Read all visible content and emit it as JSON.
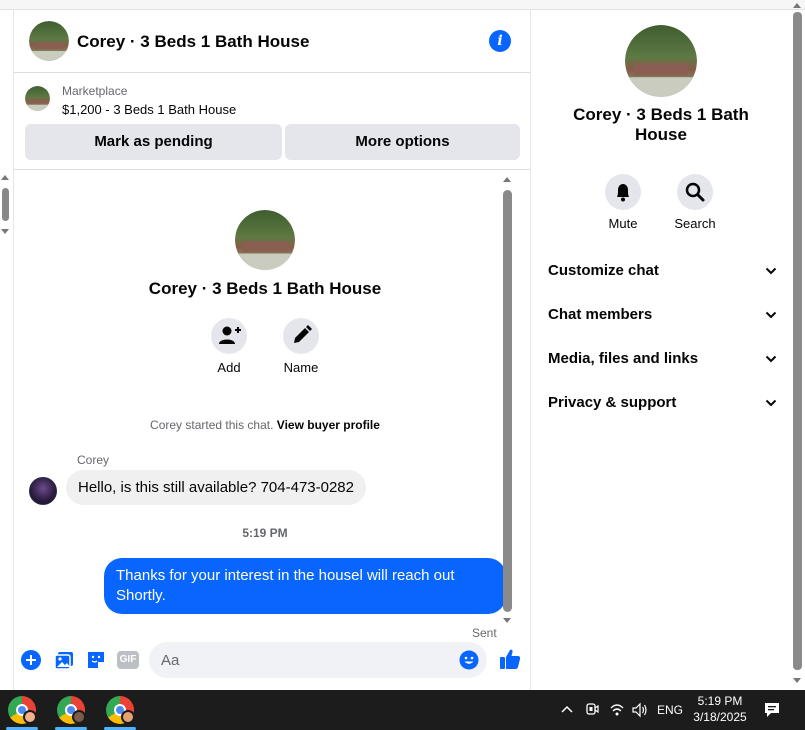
{
  "chat": {
    "title": "Corey · 3 Beds 1 Bath House"
  },
  "listing": {
    "marketplace_label": "Marketplace",
    "price_title": "$1,200 - 3 Beds 1 Bath House",
    "mark_pending_label": "Mark as pending",
    "more_options_label": "More options"
  },
  "intro": {
    "title": "Corey · 3 Beds 1 Bath House",
    "add_label": "Add",
    "name_label": "Name",
    "started_text": "Corey started this chat.",
    "view_profile_link": "View buyer profile"
  },
  "messages": {
    "sender_name": "Corey",
    "incoming_text": "Hello, is this still available? 704-473-0282",
    "timestamp": "5:19 PM",
    "outgoing_text": "Thanks for your interest in the housel will reach out Shortly.",
    "sent_label": "Sent"
  },
  "composer": {
    "placeholder": "Aa",
    "gif_label": "GIF"
  },
  "sidebar": {
    "title": "Corey · 3 Beds 1 Bath House",
    "mute_label": "Mute",
    "search_label": "Search",
    "sections": [
      "Customize chat",
      "Chat members",
      "Media, files and links",
      "Privacy & support"
    ]
  },
  "taskbar": {
    "language": "ENG",
    "time": "5:19 PM",
    "date": "3/18/2025"
  },
  "colors": {
    "accent": "#0866ff",
    "bubble_in": "#f0f0f0",
    "button_gray": "#e4e6eb"
  }
}
